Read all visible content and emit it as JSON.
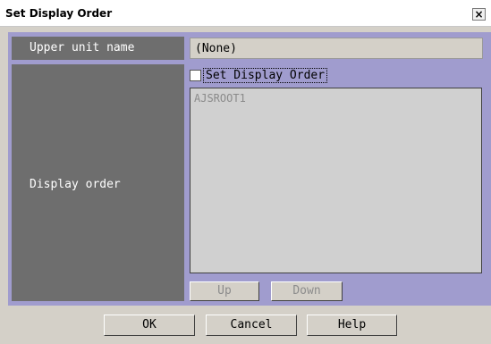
{
  "window": {
    "title": "Set Display Order",
    "close_glyph": "×"
  },
  "upper_unit": {
    "label": "Upper unit name",
    "value": "(None)"
  },
  "display_order": {
    "label": "Display order",
    "checkbox_label": "Set Display Order",
    "checkbox_checked": false,
    "items": [
      "AJSROOT1"
    ],
    "up_label": "Up",
    "down_label": "Down"
  },
  "footer": {
    "ok_label": "OK",
    "cancel_label": "Cancel",
    "help_label": "Help"
  }
}
